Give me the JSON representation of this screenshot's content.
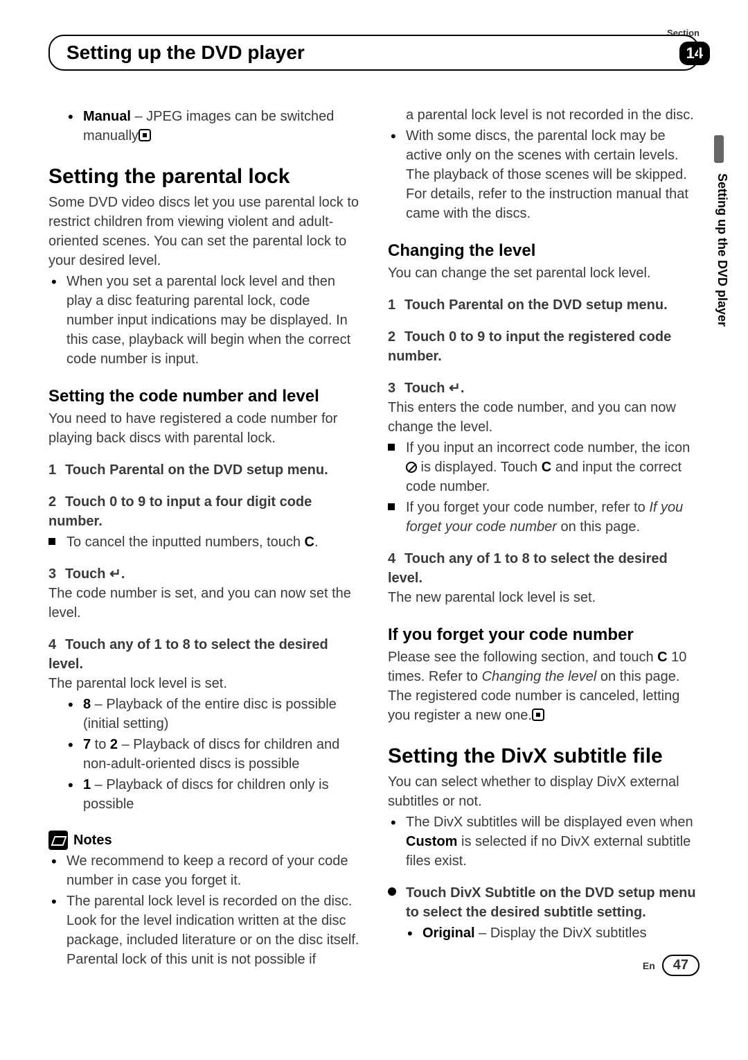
{
  "header": {
    "title": "Setting up the DVD player",
    "section_label": "Section",
    "section_number": "14",
    "side_text": "Setting up the DVD player"
  },
  "left": {
    "intro_bullet_label": "Manual",
    "intro_bullet_text": " – JPEG images can be switched manually",
    "h1_parental": "Setting the parental lock",
    "parental_intro": "Some DVD video discs let you use parental lock to restrict children from viewing violent and adult-oriented scenes. You can set the parental lock to your desired level.",
    "parental_bullet": "When you set a parental lock level and then play a disc featuring parental lock, code number input indications may be displayed. In this case, playback will begin when the correct code number is input.",
    "h2_code": "Setting the code number and level",
    "code_intro": "You need to have registered a code number for playing back discs with parental lock.",
    "step1": "Touch Parental on the DVD setup menu.",
    "step2": "Touch 0 to 9 to input a four digit code number.",
    "step2_sub_pre": "To cancel the inputted numbers, touch ",
    "step2_sub_c": "C",
    "step2_sub_post": ".",
    "step3": "Touch ↵.",
    "step3_sub": "The code number is set, and you can now set the level.",
    "step4": "Touch any of 1 to 8 to select the desired level.",
    "step4_sub": "The parental lock level is set.",
    "level8_b": "8",
    "level8": " – Playback of the entire disc is possible (initial setting)",
    "level72_b1": "7",
    "level72_mid": " to ",
    "level72_b2": "2",
    "level72": " – Playback of discs for children and non-adult-oriented discs is possible",
    "level1_b": "1",
    "level1": " – Playback of discs for children only is possible",
    "notes_label": "Notes",
    "note1": "We recommend to keep a record of your code number in case you forget it.",
    "note2": "The parental lock level is recorded on the disc. Look for the level indication written at the disc package, included literature or on the disc itself. Parental lock of this unit is not possible if"
  },
  "right": {
    "cont1": "a parental lock level is not recorded in the disc.",
    "cont2": "With some discs, the parental lock may be active only on the scenes with certain levels. The playback of those scenes will be skipped. For details, refer to the instruction manual that came with the discs.",
    "h2_change": "Changing the level",
    "change_intro": "You can change the set parental lock level.",
    "cstep1": "Touch Parental on the DVD setup menu.",
    "cstep2": "Touch 0 to 9 to input the registered code number.",
    "cstep3": "Touch ↵.",
    "cstep3_sub": "This enters the code number, and you can now change the level.",
    "csq1_pre": "If you input an incorrect code number, the icon ",
    "csq1_mid": " is displayed. Touch ",
    "csq1_c": "C",
    "csq1_post": " and input the correct code number.",
    "csq2_pre": "If you forget your code number, refer to ",
    "csq2_em": "If you forget your code number",
    "csq2_post": " on this page.",
    "cstep4": "Touch any of 1 to 8 to select the desired level.",
    "cstep4_sub": "The new parental lock level is set.",
    "h2_forget": "If you forget your code number",
    "forget_pre": "Please see the following section, and touch ",
    "forget_c": "C",
    "forget_mid": " 10 times. Refer to ",
    "forget_em": "Changing the level",
    "forget_post": " on this page. The registered code number is canceled, letting you register a new one.",
    "h1_divx": "Setting the DivX subtitle file",
    "divx_intro": "You can select whether to display DivX external subtitles or not.",
    "divx_bullet_pre": "The DivX subtitles will be displayed even when ",
    "divx_bullet_b": "Custom",
    "divx_bullet_post": " is selected if no DivX external subtitle files exist.",
    "divx_step": "Touch DivX Subtitle on the DVD setup menu to select the desired subtitle setting.",
    "divx_opt_b": "Original",
    "divx_opt": " – Display the DivX subtitles"
  },
  "footer": {
    "lang": "En",
    "page": "47"
  }
}
